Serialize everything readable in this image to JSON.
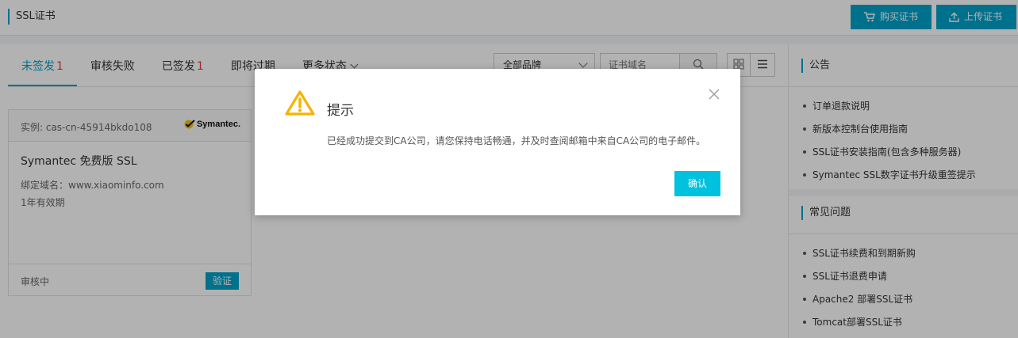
{
  "header": {
    "title": "SSL证书",
    "buy_label": "购买证书",
    "upload_label": "上传证书"
  },
  "tabs": [
    {
      "label": "未签发",
      "count": "1",
      "active": true
    },
    {
      "label": "审核失败",
      "count": ""
    },
    {
      "label": "已签发",
      "count": "1"
    },
    {
      "label": "即将过期",
      "count": ""
    },
    {
      "label": "更多状态",
      "count": ""
    }
  ],
  "filters": {
    "brand_value": "全部品牌",
    "search_placeholder": "证书域名"
  },
  "card": {
    "instance_id": "实例: cas-cn-45914bkdo108",
    "brand_logo": "Symantec.",
    "product_name": "Symantec 免费版 SSL",
    "domain": "绑定域名：www.xiaominfo.com",
    "validity": "1年有效期",
    "status": "审核中",
    "verify_label": "验证"
  },
  "sidebar": {
    "announcement_title": "公告",
    "announcements": [
      "订单退款说明",
      "新版本控制台使用指南",
      "SSL证书安装指南(包含多种服务器)",
      "Symantec SSL数字证书升级重签提示"
    ],
    "faq_title": "常见问题",
    "faqs": [
      "SSL证书续费和到期新购",
      "SSL证书退费申请",
      "Apache2 部署SSL证书",
      "Tomcat部署SSL证书"
    ]
  },
  "modal": {
    "title": "提示",
    "message": "已经成功提交到CA公司，请您保持电话畅通，并及时查阅邮箱中来自CA公司的电子邮件。",
    "confirm_label": "确认"
  },
  "colors": {
    "accent": "#00a2ca",
    "confirm": "#00c1de",
    "warning": "#f5b400",
    "count": "#e4393c"
  }
}
